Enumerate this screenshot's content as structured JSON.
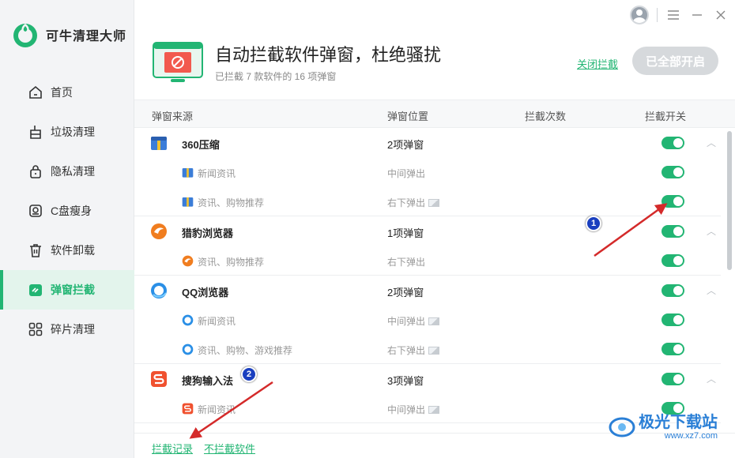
{
  "app": {
    "name": "可牛清理大师"
  },
  "sidebar": {
    "items": [
      {
        "label": "首页",
        "icon": "home-icon"
      },
      {
        "label": "垃圾清理",
        "icon": "broom-icon"
      },
      {
        "label": "隐私清理",
        "icon": "lock-icon"
      },
      {
        "label": "C盘瘦身",
        "icon": "drive-icon"
      },
      {
        "label": "软件卸载",
        "icon": "trash-icon"
      },
      {
        "label": "弹窗拦截",
        "icon": "popup-block-icon",
        "active": true
      },
      {
        "label": "碎片清理",
        "icon": "grid-icon"
      }
    ]
  },
  "header": {
    "title": "自动拦截软件弹窗，杜绝骚扰",
    "subtitle": "已拦截 7 款软件的 16 项弹窗",
    "close_link": "关闭拦截",
    "all_on_button": "已全部开启"
  },
  "table": {
    "columns": {
      "source": "弹窗来源",
      "position": "弹窗位置",
      "count": "拦截次数",
      "switch": "拦截开关"
    }
  },
  "groups": [
    {
      "name": "360压缩",
      "position": "2项弹窗",
      "icon": "360zip-icon",
      "enabled": true,
      "children": [
        {
          "name": "新闻资讯",
          "position": "中间弹出",
          "has_image": false,
          "enabled": true
        },
        {
          "name": "资讯、购物推荐",
          "position": "右下弹出",
          "has_image": true,
          "enabled": true
        }
      ]
    },
    {
      "name": "猎豹浏览器",
      "position": "1项弹窗",
      "icon": "liebao-browser-icon",
      "enabled": true,
      "children": [
        {
          "name": "资讯、购物推荐",
          "position": "右下弹出",
          "has_image": false,
          "enabled": true
        }
      ]
    },
    {
      "name": "QQ浏览器",
      "position": "2项弹窗",
      "icon": "qq-browser-icon",
      "enabled": true,
      "children": [
        {
          "name": "新闻资讯",
          "position": "中间弹出",
          "has_image": true,
          "enabled": true
        },
        {
          "name": "资讯、购物、游戏推荐",
          "position": "右下弹出",
          "has_image": true,
          "enabled": true
        }
      ]
    },
    {
      "name": "搜狗输入法",
      "position": "3项弹窗",
      "icon": "sogou-input-icon",
      "enabled": true,
      "children": [
        {
          "name": "新闻资讯",
          "position": "中间弹出",
          "has_image": true,
          "enabled": true
        }
      ]
    }
  ],
  "footer": {
    "record_link": "拦截记录",
    "unblocked_link": "不拦截软件"
  },
  "annotations": {
    "badge1": "1",
    "badge2": "2"
  },
  "watermark": {
    "text": "极光下载站",
    "url": "www.xz7.com"
  },
  "colors": {
    "accent": "#22b573",
    "annotation": "#d42a2a",
    "badge": "#1a3fbf"
  }
}
